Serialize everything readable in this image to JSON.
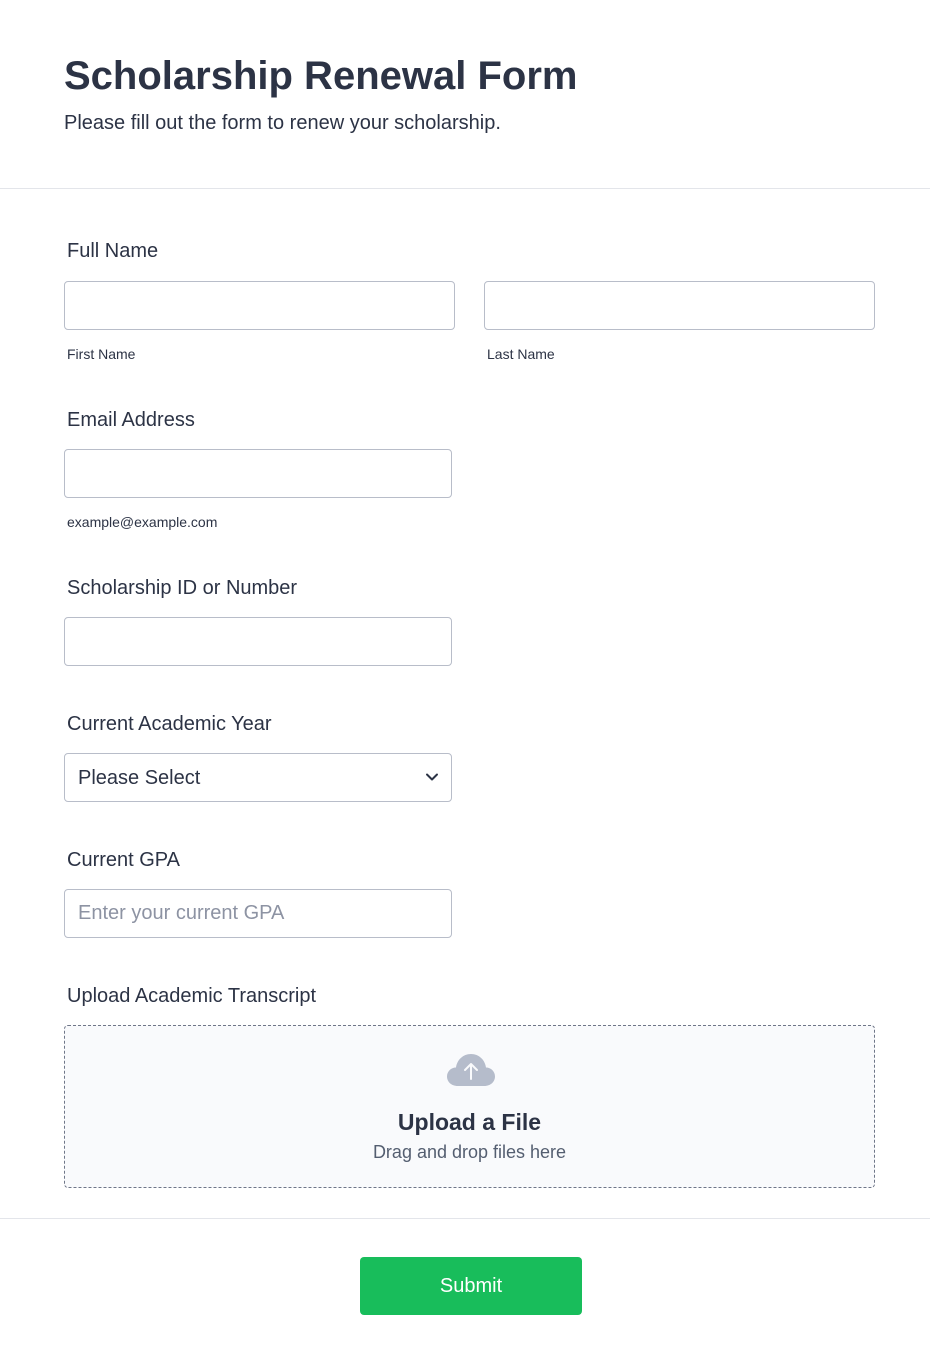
{
  "header": {
    "title": "Scholarship Renewal Form",
    "subtitle": "Please fill out the form to renew your scholarship."
  },
  "full_name": {
    "label": "Full Name",
    "first_sublabel": "First Name",
    "last_sublabel": "Last Name",
    "first_value": "",
    "last_value": ""
  },
  "email": {
    "label": "Email Address",
    "sublabel": "example@example.com",
    "value": ""
  },
  "scholarship_id": {
    "label": "Scholarship ID or Number",
    "value": ""
  },
  "academic_year": {
    "label": "Current Academic Year",
    "selected": "Please Select"
  },
  "gpa": {
    "label": "Current GPA",
    "placeholder": "Enter your current GPA",
    "value": ""
  },
  "transcript": {
    "label": "Upload Academic Transcript",
    "upload_title": "Upload a File",
    "upload_hint": "Drag and drop files here",
    "icon": "cloud-upload-icon"
  },
  "actions": {
    "submit_label": "Submit"
  },
  "colors": {
    "submit": "#18bd5b",
    "text": "#2c3345",
    "border": "#b8bdc9"
  }
}
